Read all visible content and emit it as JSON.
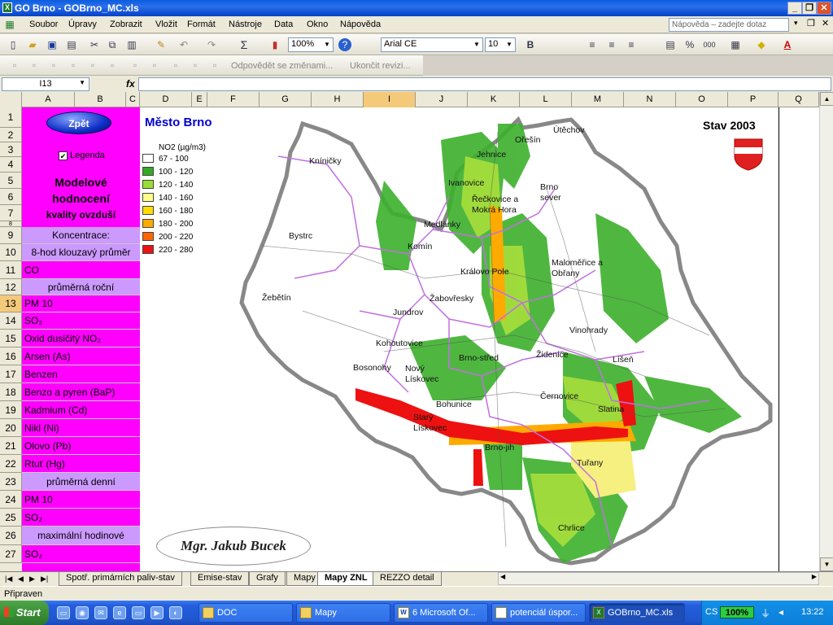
{
  "window": {
    "title": "GO Brno - GOBrno_MC.xls"
  },
  "menu": {
    "items": [
      "Soubor",
      "Úpravy",
      "Zobrazit",
      "Vložit",
      "Formát",
      "Nástroje",
      "Data",
      "Okno",
      "Nápověda"
    ],
    "ask_placeholder": "Nápověda – zadejte dotaz"
  },
  "toolbar": {
    "zoom": "100%",
    "font_name": "Arial CE",
    "font_size": "10",
    "review_reply": "Odpovědět se změnami...",
    "review_end": "Ukončit revizi..."
  },
  "formula": {
    "cell": "I13",
    "fx": "fx",
    "value": ""
  },
  "columns": [
    "A",
    "B",
    "C",
    "D",
    "E",
    "F",
    "G",
    "H",
    "I",
    "J",
    "K",
    "L",
    "M",
    "N",
    "O",
    "P",
    "Q"
  ],
  "selected_column": "I",
  "rows": [
    "1",
    "2",
    "3",
    "4",
    "5",
    "6",
    "7",
    "8",
    "9",
    "10",
    "11",
    "12",
    "13",
    "14",
    "15",
    "16",
    "17",
    "18",
    "19",
    "20",
    "21",
    "22",
    "23",
    "24",
    "25",
    "26",
    "27"
  ],
  "selected_row": "13",
  "panel": {
    "back_button": "Zpět",
    "legend_checkbox": "Legenda",
    "legend_checked": true,
    "title_line1": "Modelové",
    "title_line2": "hodnocení",
    "title_line3": "kvality ovzduší",
    "items": [
      {
        "text": "Koncentrace:",
        "style": "purple"
      },
      {
        "text": "8-hod klouzavý průměr",
        "style": "purple"
      },
      {
        "text": "CO",
        "style": "magenta"
      },
      {
        "text": "průměrná roční",
        "style": "purple"
      },
      {
        "text": "PM 10",
        "style": "magenta"
      },
      {
        "text": "SO₂",
        "style": "magenta"
      },
      {
        "text": "Oxid dusičitý NO₂",
        "style": "magenta"
      },
      {
        "text": "Arsen (As)",
        "style": "magenta"
      },
      {
        "text": "Benzen",
        "style": "magenta"
      },
      {
        "text": "Benzo a pyren (BaP)",
        "style": "magenta"
      },
      {
        "text": "Kadmium (Cd)",
        "style": "magenta"
      },
      {
        "text": "Nikl (Ni)",
        "style": "magenta"
      },
      {
        "text": "Olovo (Pb)",
        "style": "magenta"
      },
      {
        "text": "Rtuť (Hg)",
        "style": "magenta"
      },
      {
        "text": "průměrná denní",
        "style": "purple"
      },
      {
        "text": "PM 10",
        "style": "magenta"
      },
      {
        "text": "SO₂",
        "style": "magenta"
      },
      {
        "text": "maximální hodinové",
        "style": "purple"
      },
      {
        "text": "SO₂",
        "style": "magenta"
      }
    ]
  },
  "map": {
    "title": "Město Brno",
    "state": "Stav 2003",
    "legend_title": "NO2 (µg/m3)",
    "legend": [
      {
        "label": "67 - 100",
        "color": "#ffffff"
      },
      {
        "label": "100 - 120",
        "color": "#33aa22"
      },
      {
        "label": "120 - 140",
        "color": "#99dd33"
      },
      {
        "label": "140 - 160",
        "color": "#ffff88"
      },
      {
        "label": "160 - 180",
        "color": "#ffdd00"
      },
      {
        "label": "180 - 200",
        "color": "#ffaa00"
      },
      {
        "label": "200 - 220",
        "color": "#ff6600"
      },
      {
        "label": "220 - 280",
        "color": "#ee1111"
      }
    ],
    "places": [
      "Kníničky",
      "Bystrc",
      "Žebětín",
      "Komín",
      "Medlánky",
      "Ivanovice",
      "Jehnice",
      "Ořešín",
      "Útěchov",
      "Řečkovice a Mokrá Hora",
      "Brno sever",
      "Královo Pole",
      "Maloměřice a Obřany",
      "Žabovřesky",
      "Jundrov",
      "Kohoutovice",
      "Vinohrady",
      "Židenice",
      "Líšeň",
      "Brno-střed",
      "Bosonohy",
      "Nový Lískovec",
      "Bohunice",
      "Černovice",
      "Slatina",
      "Starý Lískovec",
      "Brno-jih",
      "Tuřany",
      "Chrlice"
    ],
    "signature": "Mgr. Jakub Bucek"
  },
  "sheets": [
    "Spotř. primárních paliv-stav",
    "Emise-stav",
    "Grafy",
    "Mapy",
    "Mapy ZNL",
    "REZZO detail"
  ],
  "active_sheet": "Mapy ZNL",
  "status": "Připraven",
  "taskbar": {
    "start": "Start",
    "tasks": [
      "DOC",
      "Mapy",
      "6 Microsoft Of...",
      "potenciál úspor...",
      "GOBrno_MC.xls"
    ],
    "active_task": "GOBrno_MC.xls",
    "battery": "100%",
    "clock": "13:22"
  }
}
